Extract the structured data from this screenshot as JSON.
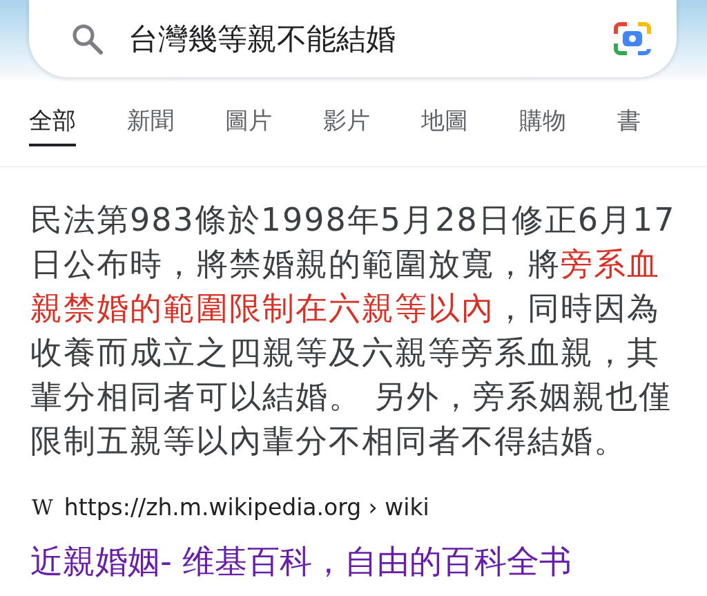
{
  "search": {
    "query": "台灣幾等親不能結婚"
  },
  "tabs": [
    {
      "label": "全部",
      "selected": true
    },
    {
      "label": "新聞",
      "selected": false
    },
    {
      "label": "圖片",
      "selected": false
    },
    {
      "label": "影片",
      "selected": false
    },
    {
      "label": "地圖",
      "selected": false
    },
    {
      "label": "購物",
      "selected": false
    },
    {
      "label": "書",
      "selected": false
    }
  ],
  "snippet": [
    {
      "text": "民法第983條於1998年5月28日修正6月17日公布時，將禁婚親的範圍放寬，將",
      "highlight": false
    },
    {
      "text": "旁系血親禁婚的範圍限制在六親等以內",
      "highlight": true
    },
    {
      "text": "，同時因為收養而成立之四親等及六親等旁系血親，其輩分相同者可以結婚。 另外，旁系姻親也僅限制五親等以內輩分不相同者不得結婚。",
      "highlight": false
    }
  ],
  "source": {
    "site_icon": "W",
    "url": "https://zh.m.wikipedia.org › wiki"
  },
  "result_title": "近親婚姻- 维基百科，自由的百科全书"
}
